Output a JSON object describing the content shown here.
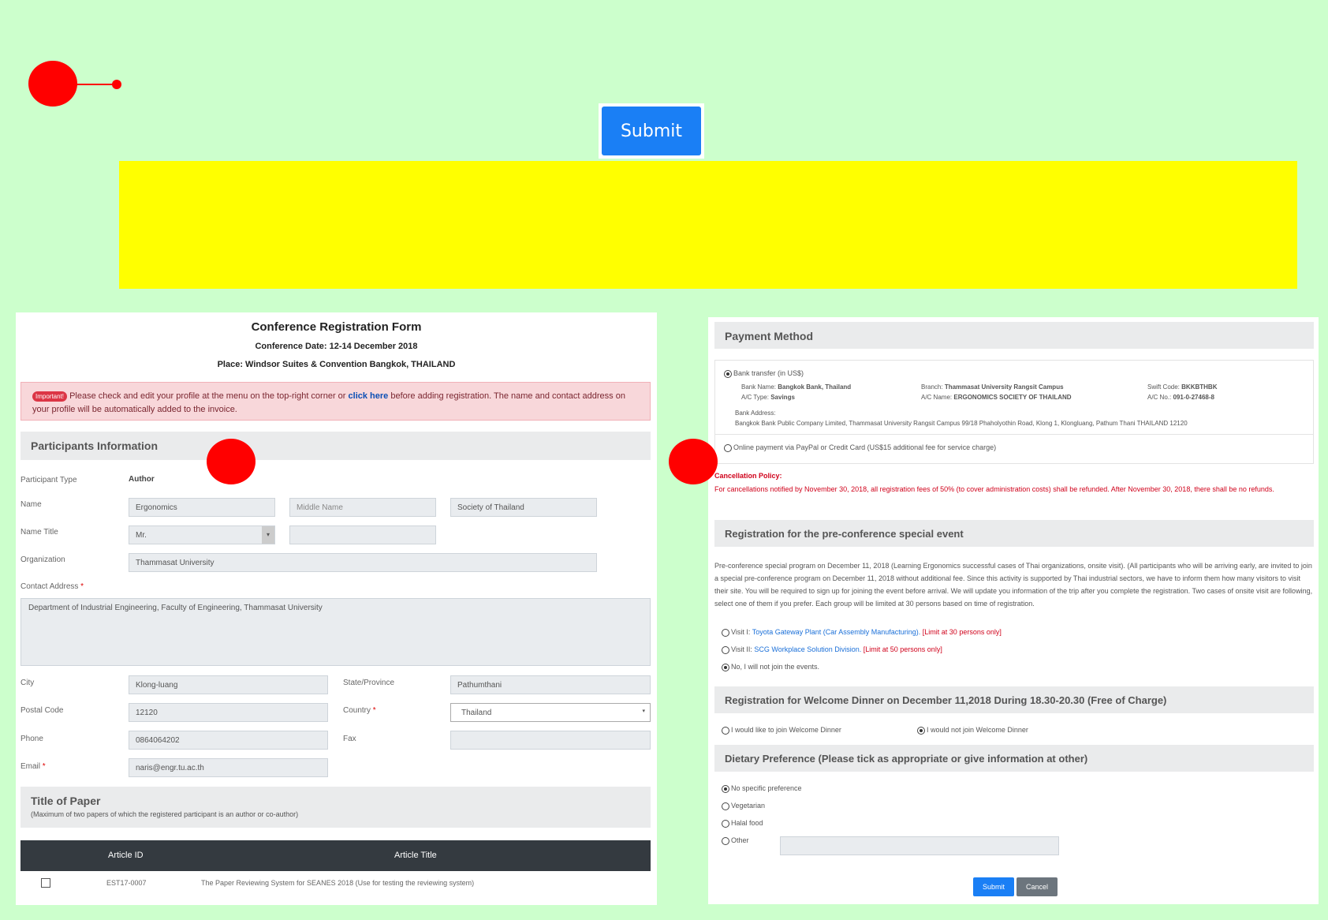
{
  "submit_button": "Submit",
  "form": {
    "title": "Conference Registration Form",
    "date": "Conference Date: 12-14 December 2018",
    "place": "Place: Windsor Suites & Convention Bangkok, THAILAND",
    "alert": {
      "badge": "Important!",
      "text_before": "Please check and edit your profile at the menu on the top-right corner or",
      "link": "click here",
      "text_after": "before adding registration. The name and contact address on your profile will be automatically added to the invoice."
    },
    "participants": {
      "heading": "Participants Information",
      "type_label": "Participant Type",
      "type_value": "Author",
      "name_label": "Name",
      "first_name": "Ergonomics",
      "middle_placeholder": "Middle Name",
      "last_name": "Society of Thailand",
      "title_label": "Name Title",
      "title_value": "Mr.",
      "org_label": "Organization",
      "org_value": "Thammasat University",
      "address_label": "Contact Address",
      "address_value": "Department of Industrial Engineering, Faculty of Engineering, Thammasat University",
      "city_label": "City",
      "city_value": "Klong-luang",
      "state_label": "State/Province",
      "state_value": "Pathumthani",
      "postal_label": "Postal Code",
      "postal_value": "12120",
      "country_label": "Country",
      "country_value": "Thailand",
      "phone_label": "Phone",
      "phone_value": "0864064202",
      "fax_label": "Fax",
      "email_label": "Email",
      "email_value": "naris@engr.tu.ac.th",
      "required_mark": "*"
    },
    "paper": {
      "heading": "Title of Paper",
      "note": "(Maximum of two papers of which the registered participant is an author or co-author)",
      "col_id": "Article ID",
      "col_title": "Article Title",
      "rows": [
        {
          "id": "EST17-0007",
          "title": "The Paper Reviewing System for SEANES 2018 (Use for testing the reviewing system)"
        }
      ]
    }
  },
  "payment": {
    "heading": "Payment Method",
    "bank_option": "Bank transfer (in US$)",
    "bank_name_label": "Bank Name:",
    "bank_name": "Bangkok Bank, Thailand",
    "branch_label": "Branch:",
    "branch": "Thammasat University Rangsit Campus",
    "swift_label": "Swift Code:",
    "swift": "BKKBTHBK",
    "ac_type_label": "A/C Type:",
    "ac_type": "Savings",
    "ac_name_label": "A/C Name:",
    "ac_name": "ERGONOMICS SOCIETY OF THAILAND",
    "ac_no_label": "A/C No.:",
    "ac_no": "091-0-27468-8",
    "bank_address_label": "Bank Address:",
    "bank_address": "Bangkok Bank Public Company Limited, Thammasat University Rangsit Campus 99/18 Phaholyothin Road, Klong 1, Klongluang, Pathum Thani THAILAND 12120",
    "online_option": "Online payment via PayPal or Credit Card (US$15 additional fee for service charge)",
    "cancel_title": "Cancellation Policy:",
    "cancel_text": "For cancellations notified by November 30, 2018, all registration fees of 50% (to cover administration costs) shall be refunded. After November 30, 2018, there shall be no refunds."
  },
  "pre_event": {
    "heading": "Registration for the pre-conference special event",
    "description": "Pre-conference special program on December 11, 2018 (Learning Ergonomics successful cases of Thai organizations, onsite visit). (All participants who will be arriving early, are invited to join a special pre-conference program on December 11, 2018 without additional fee. Since this activity is supported by Thai industrial sectors, we have to inform them how many visitors to visit their site. You will be required to sign up for joining the event before arrival. We will update you information of the trip after you complete the registration. Two cases of onsite visit are following, select one of them if you prefer. Each group will be limited at 30 persons based on time of registration.",
    "visit1_label": "Visit I:",
    "visit1_link": "Toyota Gateway Plant (Car Assembly Manufacturing).",
    "visit1_limit": "[Limit at 30 persons only]",
    "visit2_label": "Visit II:",
    "visit2_link": "SCG Workplace Solution Division.",
    "visit2_limit": "[Limit at 50 persons only]",
    "no_visit": "No, I will not join the events."
  },
  "dinner": {
    "heading": "Registration for Welcome Dinner on December 11,2018 During 18.30-20.30 (Free of Charge)",
    "yes": "I would like to join Welcome Dinner",
    "no": "I would not join Welcome Dinner"
  },
  "dietary": {
    "heading": "Dietary Preference (Please tick as appropriate or give information at other)",
    "options": [
      "No specific preference",
      "Vegetarian",
      "Halal food",
      "Other"
    ]
  },
  "actions": {
    "submit": "Submit",
    "cancel": "Cancel"
  },
  "colors": {
    "accent": "#1a7ff5",
    "background": "#ccffcc",
    "highlight": "#ffff00",
    "marker": "#ff0000"
  }
}
